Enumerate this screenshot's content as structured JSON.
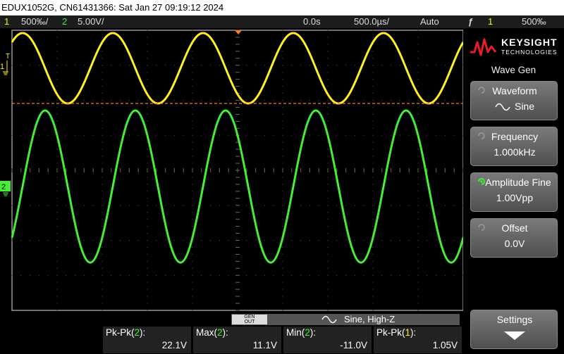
{
  "title_bar": "EDUX1052G, CN61431366: Sat Jan 27 09:19:12 2024",
  "status": {
    "ch1_num": "1",
    "ch1_scale": "500‰/",
    "ch2_num": "2",
    "ch2_scale": "5.00V/",
    "time_offset": "0.0s",
    "time_scale": "500.0µs/",
    "trigger_mode": "Auto",
    "trigger_symbol": "ƒ",
    "trigger_ch": "1",
    "trigger_level": "500‰"
  },
  "markers": {
    "trigger_t": "T",
    "ch1": "1",
    "ch2": "2"
  },
  "colors": {
    "ch1": "#ffee22",
    "ch2": "#44ee33",
    "trigger_level_line": "#ff7a1a"
  },
  "sidebar": {
    "logo_brand": "KEYSIGHT",
    "logo_sub": "TECHNOLOGIES",
    "menu_title": "Wave Gen",
    "softkeys": [
      {
        "line1": "Waveform",
        "line2": "Sine",
        "icon": "sine-wave-icon"
      },
      {
        "line1": "Frequency",
        "line2": "1.000kHz"
      },
      {
        "line1": "Amplitude Fine",
        "line2": "1.00Vpp",
        "icon": "entry-knob-active-icon"
      },
      {
        "line1": "Offset",
        "line2": "0.0V"
      },
      {
        "line1": "Settings",
        "icon": "down-arrow-icon"
      }
    ]
  },
  "gen_strip": {
    "button_line1": "GEN",
    "button_line2": "OUT",
    "text": "Sine, High-Z"
  },
  "measurements": [
    {
      "label_prefix": "Pk-Pk(",
      "ch": "2",
      "label_suffix": "):",
      "value": "22.1V"
    },
    {
      "label_prefix": "Max(",
      "ch": "2",
      "label_suffix": "):",
      "value": "11.1V"
    },
    {
      "label_prefix": "Min(",
      "ch": "2",
      "label_suffix": "):",
      "value": "-11.0V"
    },
    {
      "label_prefix": "Pk-Pk(",
      "ch": "1",
      "label_suffix": "):",
      "value": "1.05V"
    }
  ]
}
